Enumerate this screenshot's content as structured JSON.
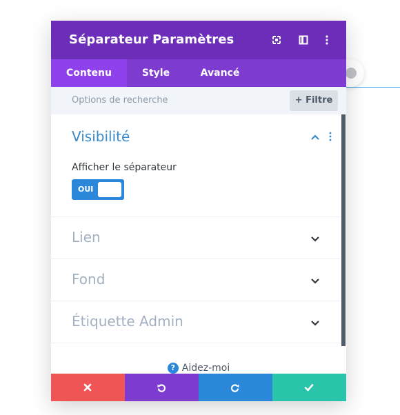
{
  "modal": {
    "title": "Séparateur Paramètres",
    "header_icons": [
      "fullscreen-icon",
      "split-view-icon",
      "more-options-icon"
    ]
  },
  "tabs": [
    {
      "label": "Contenu",
      "active": true
    },
    {
      "label": "Style",
      "active": false
    },
    {
      "label": "Avancé",
      "active": false
    }
  ],
  "search": {
    "placeholder": "Options de recherche",
    "filter_label": "+ Filtre"
  },
  "sections": [
    {
      "title": "Visibilité",
      "expanded": true,
      "field_label": "Afficher le séparateur",
      "toggle_label": "OUI",
      "toggle_on": true
    },
    {
      "title": "Lien",
      "expanded": false
    },
    {
      "title": "Fond",
      "expanded": false
    },
    {
      "title": "Étiquette Admin",
      "expanded": false
    }
  ],
  "help": {
    "label": "Aidez-moi"
  },
  "footer": {
    "buttons": [
      {
        "icon": "close-icon",
        "color": "#ef5555"
      },
      {
        "icon": "undo-icon",
        "color": "#7e3bd0"
      },
      {
        "icon": "redo-icon",
        "color": "#2b87da"
      },
      {
        "icon": "check-icon",
        "color": "#29c4a9"
      }
    ]
  },
  "colors": {
    "header": "#6c2eb9",
    "tabs": "#7e3bd0",
    "active_tab": "#8f42ec",
    "accent": "#2b87da"
  }
}
